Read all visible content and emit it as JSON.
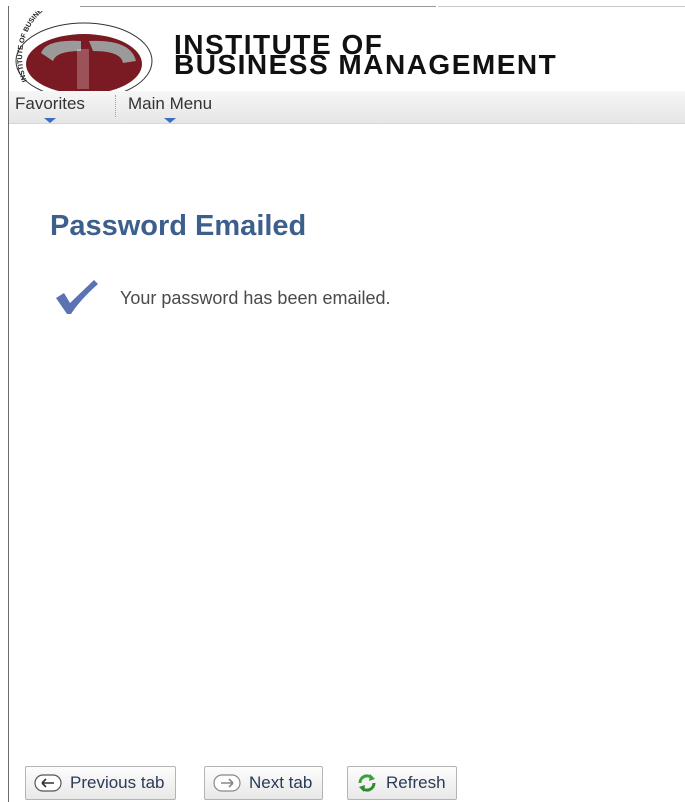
{
  "header": {
    "logo_ring_text": "INSTITUTE OF BUSINESS MANAGEMENT",
    "name_line1": "INSTITUTE OF",
    "name_line2": "BUSINESS MANAGEMENT"
  },
  "menu": {
    "favorites": "Favorites",
    "main_menu": "Main Menu"
  },
  "main": {
    "title": "Password Emailed",
    "message": "Your password has been emailed."
  },
  "footer": {
    "previous_tab": "Previous tab",
    "next_tab": "Next tab",
    "refresh": "Refresh"
  },
  "colors": {
    "title": "#3c5f8c",
    "check": "#5b73b3",
    "caret": "#3a6dc0",
    "logo_red": "#7a1a22"
  }
}
